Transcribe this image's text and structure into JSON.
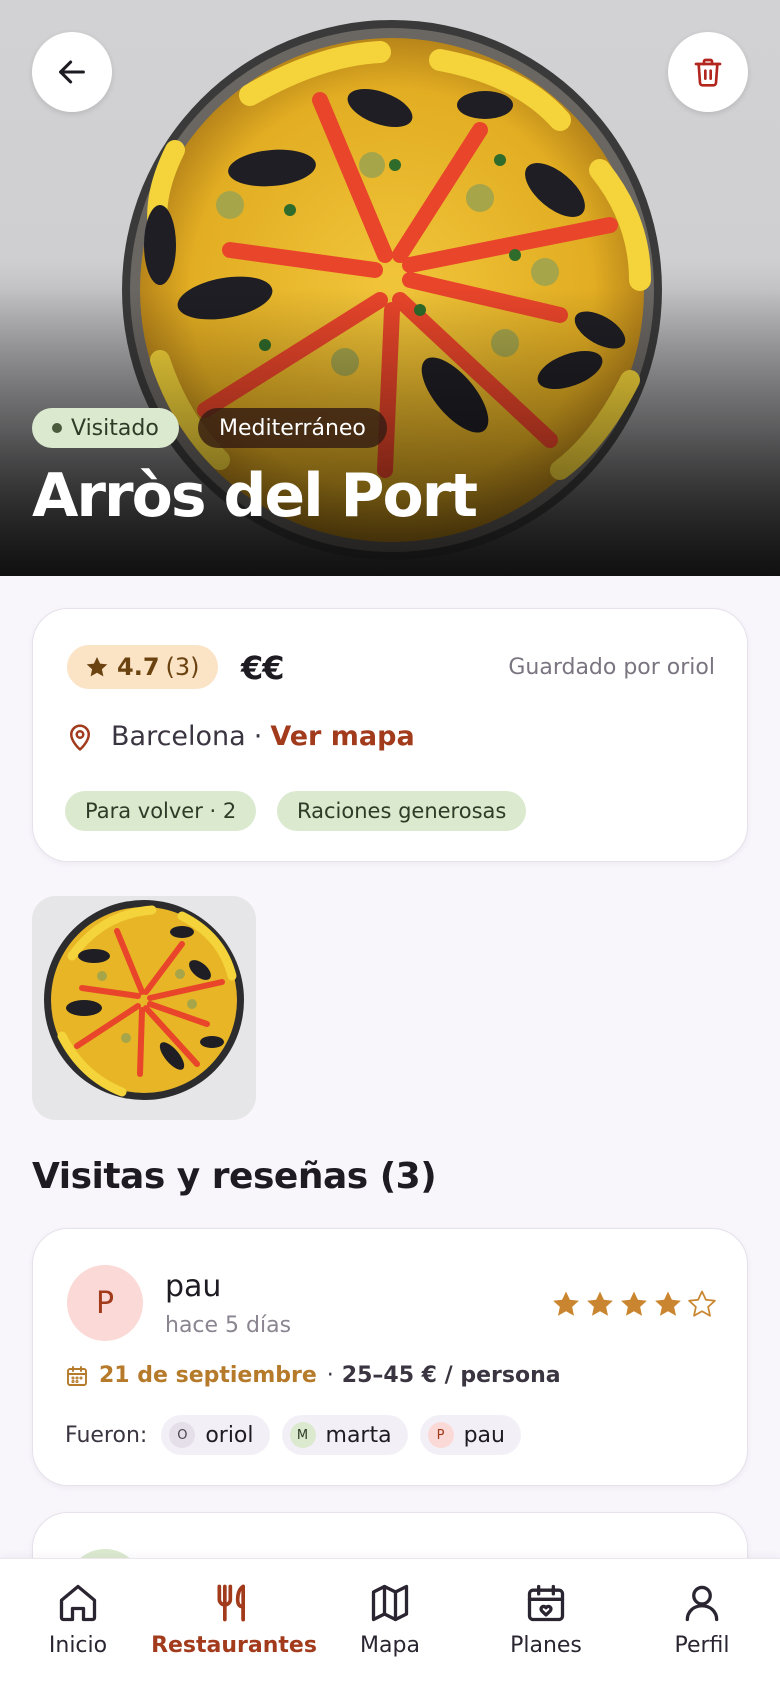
{
  "hero": {
    "status_badge": "Visitado",
    "cuisine_badge": "Mediterráneo",
    "title": "Arròs del Port",
    "back_icon": "arrow-left-icon",
    "delete_icon": "trash-icon"
  },
  "info": {
    "rating": "4.7",
    "rating_count": "(3)",
    "price_level": "€€",
    "saved_by": "Guardado por oriol",
    "city": "Barcelona",
    "separator": "·",
    "map_link": "Ver mapa",
    "tags": [
      "Para volver · 2",
      "Raciones generosas"
    ]
  },
  "section": {
    "title": "Visitas y reseñas (3)"
  },
  "review": {
    "avatar_initial": "P",
    "author": "pau",
    "time_ago": "hace 5 días",
    "stars": 4,
    "max_stars": 5,
    "date": "21 de septiembre",
    "separator": "·",
    "price_per_person": "25–45 € / persona",
    "went_label": "Fueron:",
    "companions": [
      {
        "initial": "O",
        "name": "oriol"
      },
      {
        "initial": "M",
        "name": "marta"
      },
      {
        "initial": "P",
        "name": "pau"
      }
    ]
  },
  "nav": {
    "items": [
      {
        "label": "Inicio",
        "icon": "home-icon"
      },
      {
        "label": "Restaurantes",
        "icon": "utensils-icon"
      },
      {
        "label": "Mapa",
        "icon": "map-icon"
      },
      {
        "label": "Planes",
        "icon": "calendar-heart-icon"
      },
      {
        "label": "Perfil",
        "icon": "user-icon"
      }
    ],
    "active": "Restaurantes"
  },
  "colors": {
    "accent": "#a23a1c",
    "star": "#c9852f",
    "tag_bg": "#dbe9cf",
    "rating_bg": "#fbe3c6"
  }
}
